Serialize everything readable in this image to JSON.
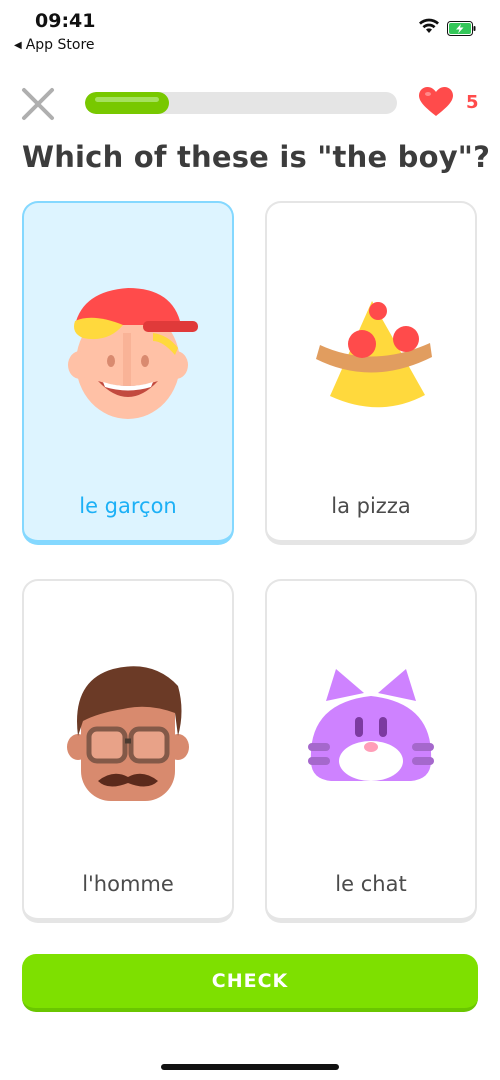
{
  "status_bar": {
    "time": "09:41",
    "back_app": "App Store"
  },
  "lesson": {
    "progress": 0.27,
    "hearts": "5",
    "question": "Which of these is \"the boy\"?"
  },
  "choices": [
    {
      "label": "le garçon",
      "icon": "boy-icon",
      "selected": true
    },
    {
      "label": "la pizza",
      "icon": "pizza-icon",
      "selected": false
    },
    {
      "label": "l'homme",
      "icon": "man-icon",
      "selected": false
    },
    {
      "label": "le chat",
      "icon": "cat-icon",
      "selected": false
    }
  ],
  "check_button": {
    "label": "CHECK"
  },
  "colors": {
    "accent_green": "#78c800",
    "selected_blue": "#1cb0f6",
    "heart_red": "#ff4b4b"
  }
}
